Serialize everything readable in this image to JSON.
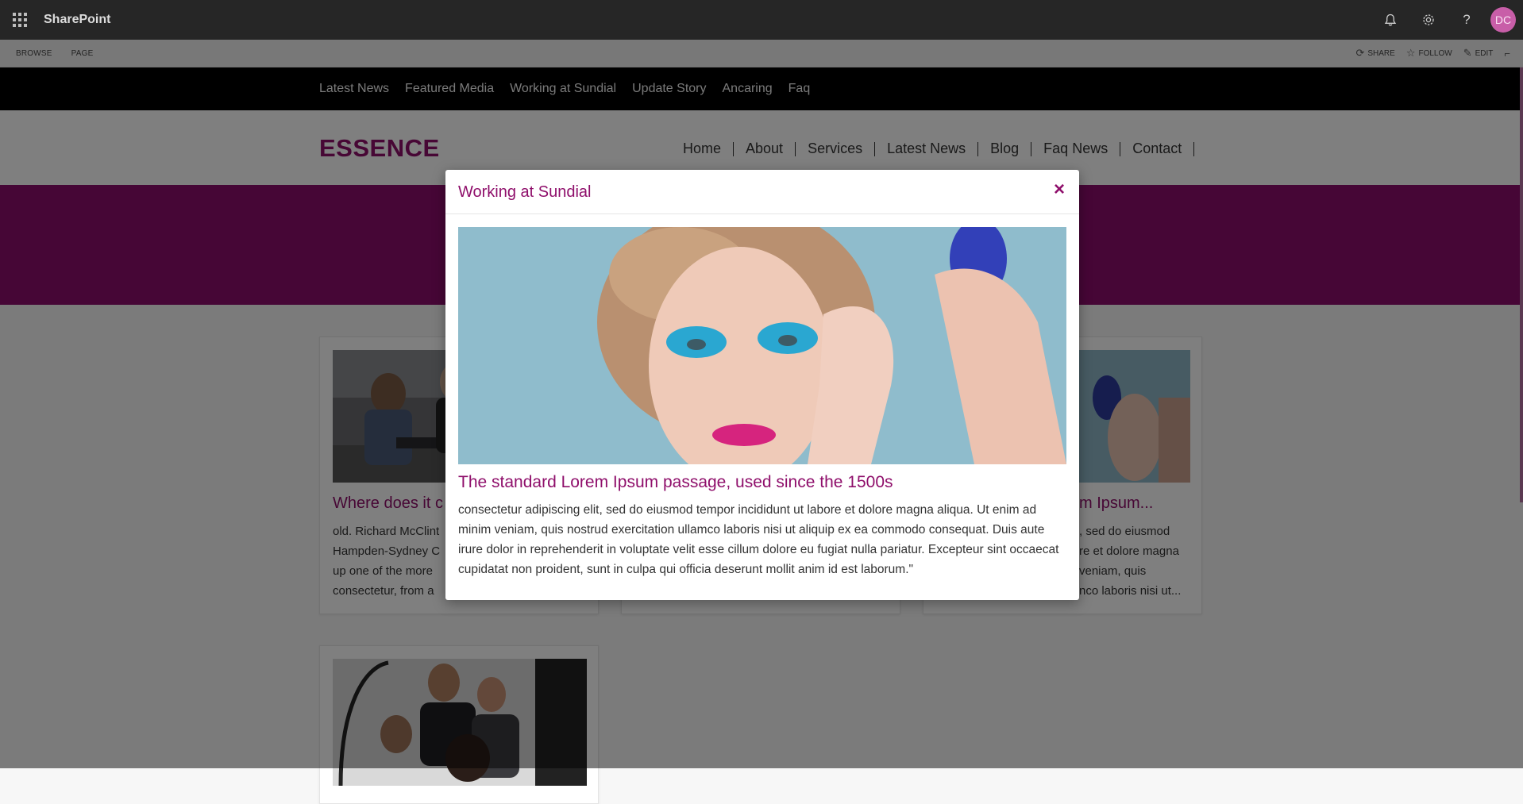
{
  "suite_bar": {
    "app_name": "SharePoint",
    "icons": [
      "bell-icon",
      "gear-icon",
      "help-icon"
    ],
    "help_glyph": "?",
    "avatar_initials": "DC"
  },
  "ribbon": {
    "tabs": [
      "BROWSE",
      "PAGE"
    ],
    "actions": [
      {
        "label": "SHARE",
        "icon": "share-icon"
      },
      {
        "label": "FOLLOW",
        "icon": "star-icon"
      },
      {
        "label": "EDIT",
        "icon": "pencil-icon"
      }
    ]
  },
  "top_nav": {
    "items": [
      "Latest News",
      "Featured Media",
      "Working at Sundial",
      "Update Story",
      "Ancaring",
      "Faq"
    ]
  },
  "header": {
    "brand": "ESSENCE",
    "nav": [
      "Home",
      "About",
      "Services",
      "Latest News",
      "Blog",
      "Faq News",
      "Contact"
    ]
  },
  "cards": [
    {
      "title": "Where does it c",
      "lines": [
        "old. Richard McClint",
        "Hampden-Sydney C",
        "up one of the more",
        "consectetur, from a"
      ]
    },
    {
      "title": "",
      "lines": []
    },
    {
      "title": "m Ipsum...",
      "lines": [
        ", sed do eiusmod",
        "re et dolore magna",
        "veniam, quis",
        "nco laboris nisi ut..."
      ]
    }
  ],
  "modal": {
    "title": "Working at Sundial",
    "close_glyph": "×",
    "heading": "The standard Lorem Ipsum passage, used since the 1500s",
    "text": "consectetur adipiscing elit, sed do eiusmod tempor incididunt ut labore et dolore magna aliqua. Ut enim ad minim veniam, quis nostrud exercitation ullamco laboris nisi ut aliquip ex ea commodo consequat. Duis aute irure dolor in reprehenderit in voluptate velit esse cillum dolore eu fugiat nulla pariatur. Excepteur sint occaecat cupidatat non proident, sunt in culpa qui officia deserunt mollit anim id est laborum.\""
  },
  "colors": {
    "brand": "#8f0f6b",
    "hero": "#8c0c6c",
    "suite_bar": "#262626",
    "top_nav": "#000000",
    "overlay": "rgba(0,0,0,0.5)"
  }
}
